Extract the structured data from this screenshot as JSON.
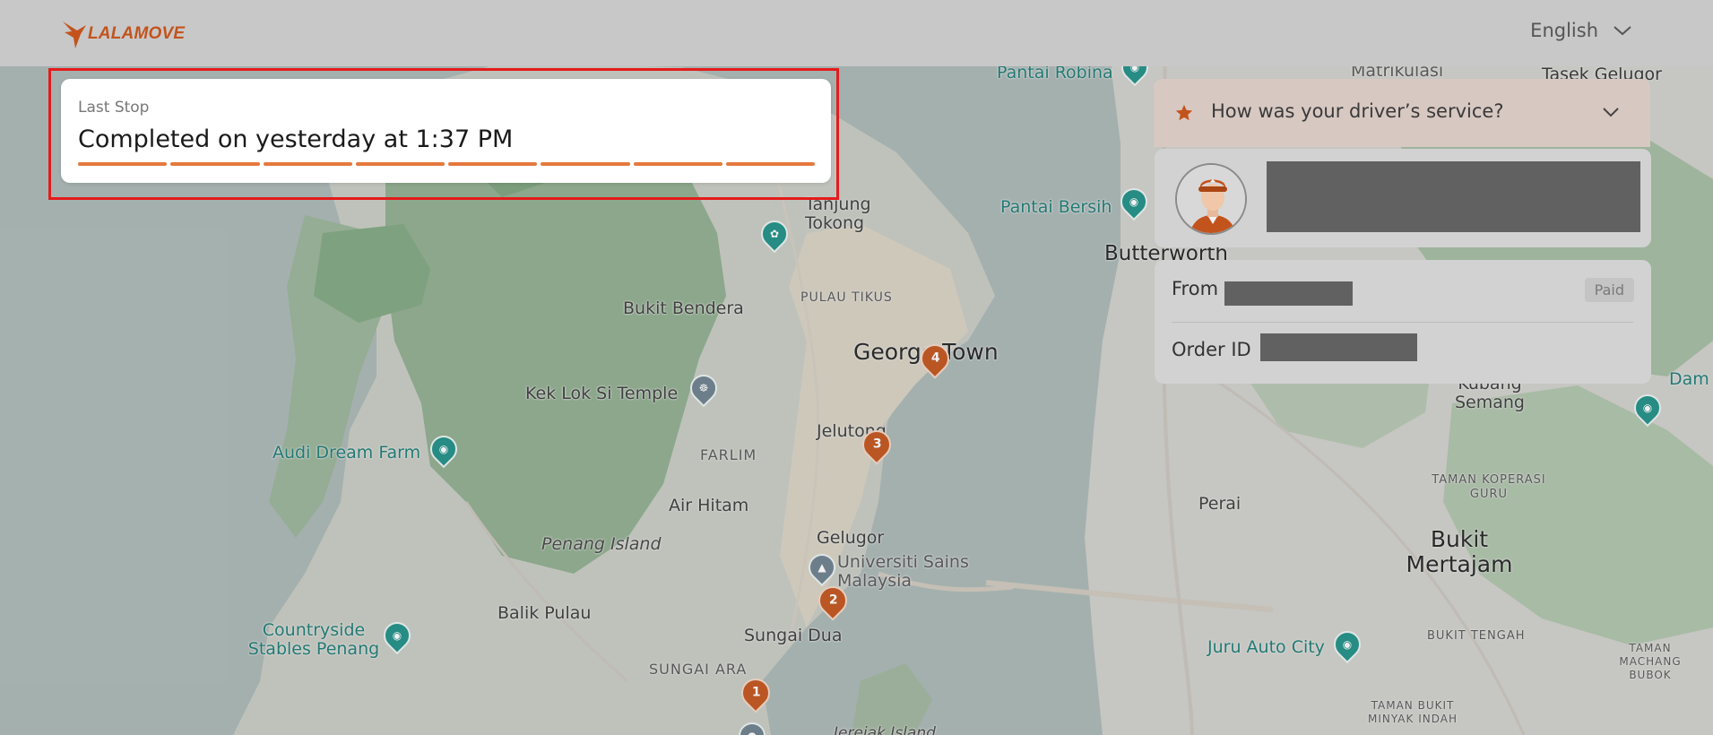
{
  "header": {
    "logo_text": "LALAMOVE",
    "language": "English"
  },
  "last_stop": {
    "label": "Last Stop",
    "status": "Completed on yesterday at 1:37 PM",
    "progress_segments": 8,
    "progress_completed": 8
  },
  "rating": {
    "question": "How was your driver’s service?"
  },
  "order": {
    "from_label": "From",
    "paid_badge": "Paid",
    "order_id_label": "Order ID"
  },
  "map": {
    "labels": {
      "pantai_robina": "Pantai Robina",
      "matrikulasi": "Matrikulasi",
      "tasek_gelugor": "Tasek Gelugor",
      "tanjung_tokong": "Tanjung Tokong",
      "pantai_bersih": "Pantai Bersih",
      "butterworth": "Butterworth",
      "bukit_bendera": "Bukit Bendera",
      "pulau_tikus": "PULAU TIKUS",
      "george_town": "George Town",
      "kek_lok_si": "Kek Lok Si Temple",
      "jelutong": "Jelutong",
      "audi_dream_farm": "Audi Dream Farm",
      "farlim": "FARLIM",
      "air_hitam": "Air Hitam",
      "penang_island": "Penang Island",
      "gelugor": "Gelugor",
      "universiti": "Universiti Sains Malaysia",
      "balik_pulau": "Balik Pulau",
      "countryside": "Countryside Stables Penang",
      "sungai_dua": "Sungai Dua",
      "sungai_ara": "SUNGAI ARA",
      "jerejak": "Jerejak Island",
      "kubang_semang": "Kubang Semang",
      "taman_koperasi": "TAMAN KOPERASI GURU",
      "perai": "Perai",
      "bukit_mertajam": "Bukit Mertajam",
      "juru_auto": "Juru Auto City",
      "bukit_tengah": "BUKIT TENGAH",
      "taman_machang": "TAMAN MACHANG BUBOK",
      "taman_bukit": "TAMAN BUKIT MINYAK INDAH",
      "dam": "Dam"
    },
    "stops": [
      "1",
      "2",
      "3",
      "4"
    ]
  },
  "colors": {
    "brand": "#c3531c",
    "progress": "#e4793d",
    "highlight": "#e41b1b",
    "redacted": "#616161"
  },
  "icons": [
    "lalamove-logo-icon",
    "chevron-down-icon",
    "star-icon",
    "driver-avatar",
    "camera-icon",
    "wheel-icon",
    "graduation-icon",
    "flower-icon"
  ]
}
